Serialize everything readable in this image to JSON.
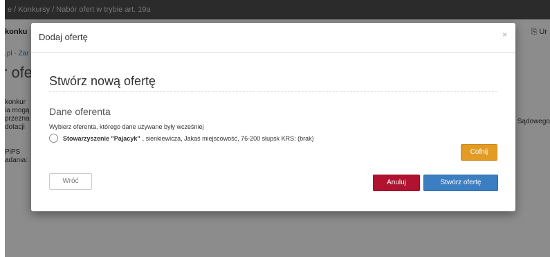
{
  "background": {
    "breadcrumb_top": "e / Konkursy / Nabór ofert w trybie art. 19a",
    "konkurs_label": "konku",
    "right_action": "Ur",
    "site_crumb": ".pl - Zar",
    "big_title": "r ofe",
    "left_lines": [
      "konkur",
      "ia mogą",
      "przezna",
      "dotacji"
    ],
    "sadowego": "Sądowego",
    "lower_lines": [
      "PiPS",
      "adania:"
    ]
  },
  "modal": {
    "title": "Dodaj ofertę",
    "close": "×",
    "section_title": "Stwórz nową ofertę",
    "subsection_title": "Dane oferenta",
    "hint": "Wybierz oferenta, którego dane używane były wcześniej",
    "option": {
      "name": "Stowarzyszenie \"Pajacyk\"",
      "details": ", sienkiewicza, Jakaś miejscowość, 76-200 słupsk KRS: (brak)"
    },
    "buttons": {
      "cofnij": "Cofnij",
      "wroc": "Wróć",
      "anuluj": "Anuluj",
      "stworz": "Stwórz ofertę"
    }
  },
  "colors": {
    "cofnij": "#e29c25",
    "anuluj": "#b0132f",
    "stworz": "#3c7ec2",
    "topbar": "#2b2b2b"
  }
}
